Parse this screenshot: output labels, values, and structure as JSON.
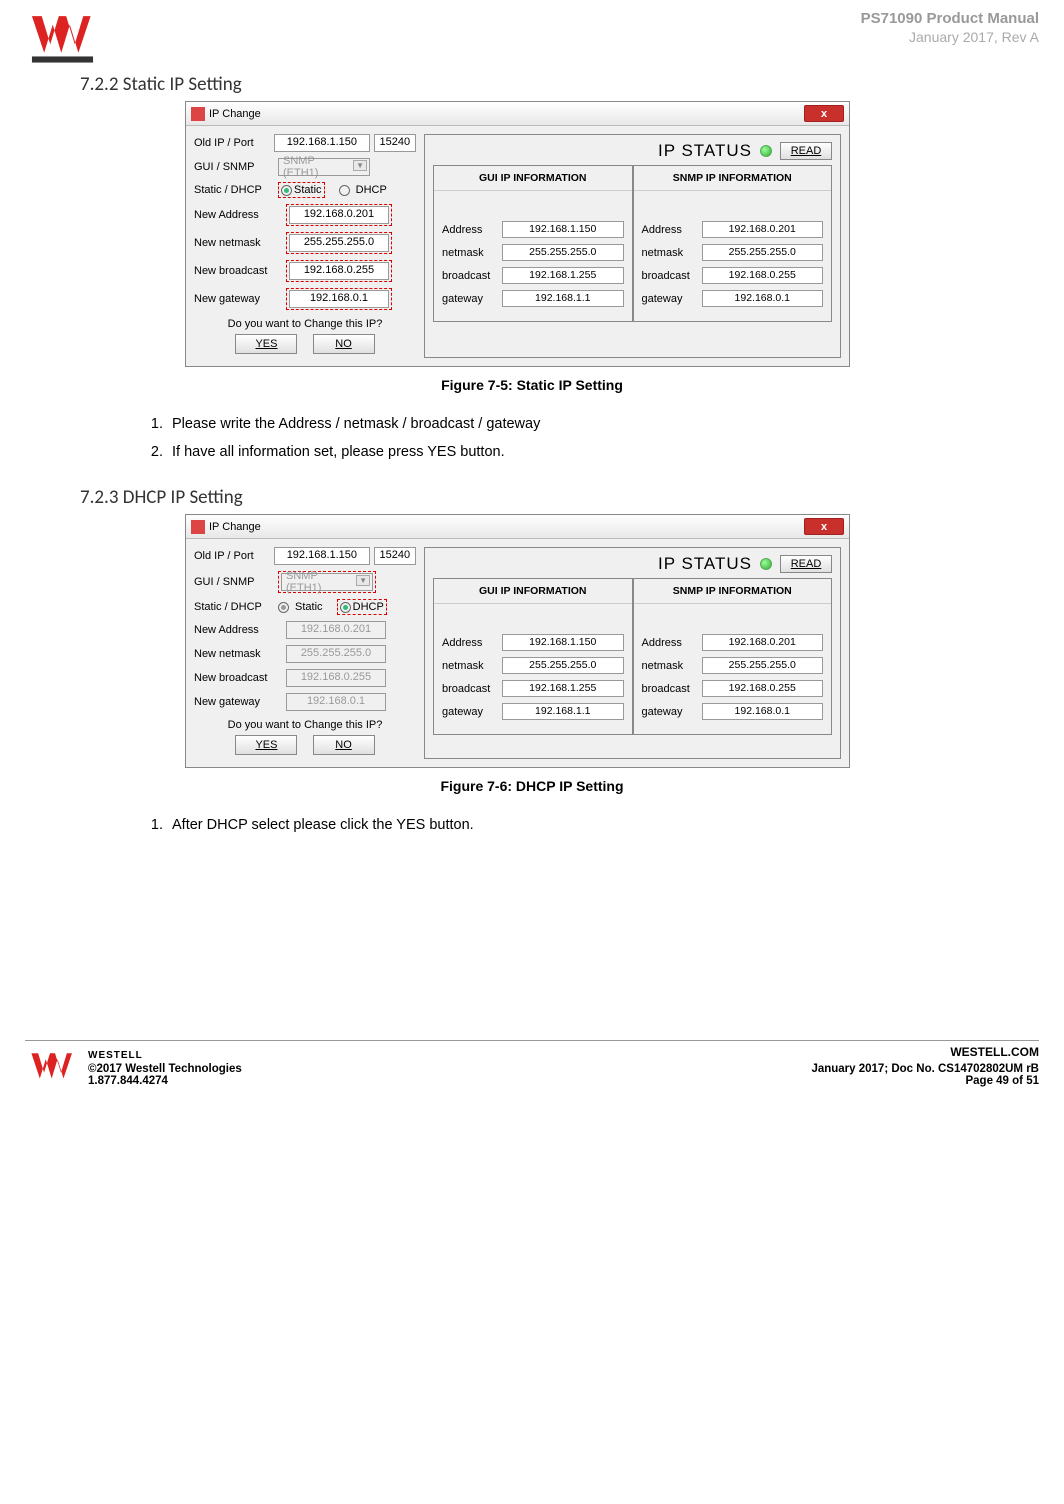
{
  "header": {
    "manual": "PS71090 Product Manual",
    "date_rev": "January 2017, Rev A"
  },
  "section1": {
    "title": "7.2.2 Static IP Setting",
    "dialog": {
      "title": "IP Change",
      "close": "x",
      "old_ip_label": "Old IP / Port",
      "old_ip": "192.168.1.150",
      "old_port": "15240",
      "gui_snmp_label": "GUI / SNMP",
      "snmp_sel": "SNMP (ETH1)",
      "static_dhcp_label": "Static / DHCP",
      "static_label": "Static",
      "dhcp_label": "DHCP",
      "new_addr_label": "New Address",
      "new_addr": "192.168.0.201",
      "new_mask_label": "New netmask",
      "new_mask": "255.255.255.0",
      "new_bcast_label": "New broadcast",
      "new_bcast": "192.168.0.255",
      "new_gw_label": "New gateway",
      "new_gw": "192.168.0.1",
      "confirm_text": "Do you want to Change this IP?",
      "yes": "YES",
      "no": "NO",
      "status_title": "IP STATUS",
      "read": "READ",
      "gui_info": "GUI IP INFORMATION",
      "snmp_info": "SNMP IP INFORMATION",
      "labels": {
        "addr": "Address",
        "mask": "netmask",
        "bcast": "broadcast",
        "gw": "gateway"
      },
      "gui_vals": {
        "addr": "192.168.1.150",
        "mask": "255.255.255.0",
        "bcast": "192.168.1.255",
        "gw": "192.168.1.1"
      },
      "snmp_vals": {
        "addr": "192.168.0.201",
        "mask": "255.255.255.0",
        "bcast": "192.168.0.255",
        "gw": "192.168.0.1"
      }
    },
    "caption": "Figure 7‑5: Static IP Setting",
    "steps": [
      "Please write the Address / netmask / broadcast / gateway",
      "If have all information set, please press YES button."
    ]
  },
  "section2": {
    "title": "7.2.3 DHCP IP Setting",
    "dialog": {
      "title": "IP Change",
      "close": "x",
      "old_ip_label": "Old IP / Port",
      "old_ip": "192.168.1.150",
      "old_port": "15240",
      "gui_snmp_label": "GUI / SNMP",
      "snmp_sel": "SNMP (ETH1)",
      "static_dhcp_label": "Static / DHCP",
      "static_label": "Static",
      "dhcp_label": "DHCP",
      "new_addr_label": "New Address",
      "new_addr": "192.168.0.201",
      "new_mask_label": "New netmask",
      "new_mask": "255.255.255.0",
      "new_bcast_label": "New broadcast",
      "new_bcast": "192.168.0.255",
      "new_gw_label": "New gateway",
      "new_gw": "192.168.0.1",
      "confirm_text": "Do you want to Change this IP?",
      "yes": "YES",
      "no": "NO",
      "status_title": "IP STATUS",
      "read": "READ",
      "gui_info": "GUI IP INFORMATION",
      "snmp_info": "SNMP IP INFORMATION",
      "labels": {
        "addr": "Address",
        "mask": "netmask",
        "bcast": "broadcast",
        "gw": "gateway"
      },
      "gui_vals": {
        "addr": "192.168.1.150",
        "mask": "255.255.255.0",
        "bcast": "192.168.1.255",
        "gw": "192.168.1.1"
      },
      "snmp_vals": {
        "addr": "192.168.0.201",
        "mask": "255.255.255.0",
        "bcast": "192.168.0.255",
        "gw": "192.168.0.1"
      }
    },
    "caption": "Figure 7‑6: DHCP IP Setting",
    "steps": [
      "After DHCP select please click the YES button."
    ]
  },
  "footer": {
    "brand": "WESTELL",
    "url": "WESTELL.COM",
    "copyright": "©2017 Westell Technologies",
    "phone": "1.877.844.4274",
    "docinfo": "January 2017; Doc No. CS14702802UM rB",
    "page": "Page 49 of 51"
  }
}
